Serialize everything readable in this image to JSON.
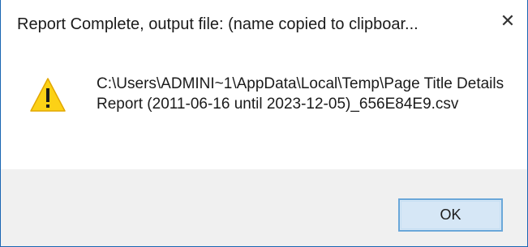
{
  "dialog": {
    "title": "Report Complete, output file: (name copied to clipboar...",
    "close_glyph": "✕",
    "icon": "warning-icon",
    "message": "C:\\Users\\ADMINI~1\\AppData\\Local\\Temp\\Page Title Details Report (2011-06-16 until 2023-12-05)_656E84E9.csv",
    "ok_label": "OK"
  },
  "colors": {
    "border": "#1a66b3",
    "footer_bg": "#f0f0f0",
    "button_bg": "#d6e7f6",
    "button_border": "#6aa7d9",
    "warning_fill": "#fcd116"
  }
}
